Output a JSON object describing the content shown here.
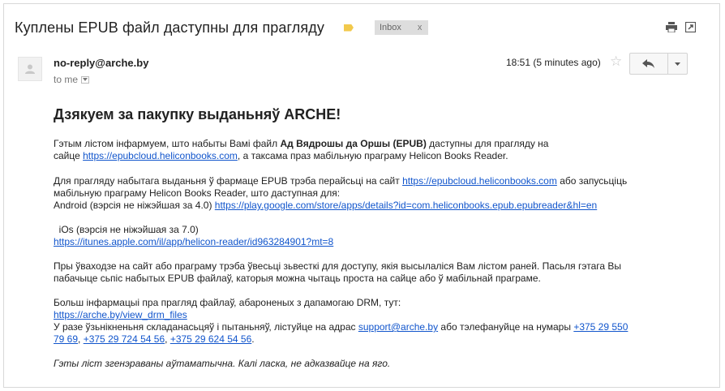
{
  "subject": "Куплены EPUB файл даступны для прагляду",
  "label": {
    "color": "#f2c94c"
  },
  "inbox_badge": {
    "label": "Inbox",
    "close": "x"
  },
  "icons": {
    "print": "print-icon",
    "new_window": "new-window-icon",
    "avatar": "avatar-icon",
    "reply": "reply-icon",
    "more": "chevron-down-icon",
    "star": "star-icon"
  },
  "sender": "no-reply@arche.by",
  "to": "to me",
  "time": "18:51 (5 minutes ago)",
  "message": {
    "heading": "Дзякуем за пакупку выданьняў ARCHE!",
    "p1_a": "Гэтым лістом інфармуем, што набыты Вамі файл ",
    "p1_bold": "Ад Вядрошы да Оршы (EPUB)",
    "p1_b": " даступны для прагляду на",
    "p1_c": "сайце ",
    "p1_link": "https://epubcloud.heliconbooks.com",
    "p1_d": ", а таксама праз мабільную праграму Helicon Books Reader.",
    "p2_a": "Для прагляду набытага выданьня ў фармаце EPUB трэба перайсьці на сайт ",
    "p2_link": "https://epubcloud.heliconbooks.com",
    "p2_b": " або запусьціць",
    "p2_c": "мабільную праграму Helicon Books Reader, што даступная для:",
    "p2_d": "Android (вэрсія не ніжэйшая за 4.0) ",
    "p2_android_link": "https://play.google.com/store/apps/details?id=com.heliconbooks.epub.epubreader&hl=en",
    "p3_a": "  iOs (вэрсія не ніжэйшая за 7.0)",
    "p3_link": "https://itunes.apple.com/il/app/helicon-reader/id963284901?mt=8",
    "p4_a": "Пры ўваходзе на сайт або праграму трэба ўвесьці зьвесткі для доступу, якія высылаліся Вам лістом раней.  Пасьля гэтага Вы",
    "p4_b": "пабачыце сьпіс набытых EPUB файлаў, каторыя можна чытаць проста на сайце або ў мабільнай праграме.",
    "p5_a": "Больш інфармацыі пра прагляд файлаў, абароненых з дапамогаю DRM, тут:",
    "p5_link": "https://arche.by/view_drm_files",
    "p5_b": "У разе ўзьнікненьня складанасьцяў і пытаньняў, лістуйце на адрас ",
    "p5_email": "support@arche.by",
    "p5_c": " або тэлефануйце на нумары ",
    "p5_phone1a": "+375 29 550",
    "p5_phone1b": "79 69",
    "p5_sep1": ", ",
    "p5_phone2": "+375 29 724 54 56",
    "p5_sep2": ", ",
    "p5_phone3": "+375 29 624 54 56",
    "p5_end": ".",
    "footer": "Гэты ліст згенэраваны аўтаматычна. Калі ласка, не адказвайце на яго."
  }
}
